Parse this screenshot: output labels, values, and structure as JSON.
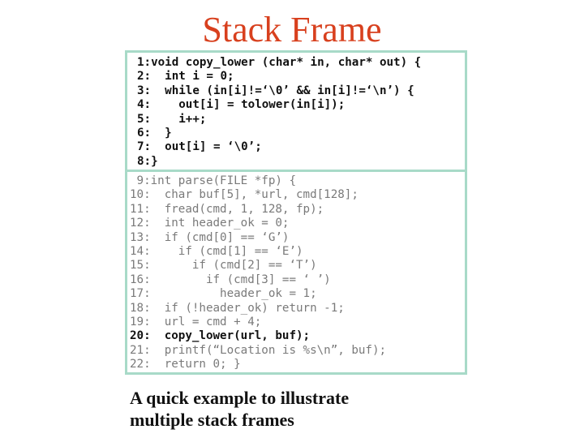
{
  "title": "Stack Frame",
  "colors": {
    "title": "#d8401e",
    "border": "#a8dac8",
    "active_code": "#111111",
    "inactive_code": "#7a7a7a"
  },
  "code_blocks": [
    {
      "function": "copy_lower",
      "active": true,
      "lines": [
        {
          "num": "1:",
          "text": "void copy_lower (char* in, char* out) {"
        },
        {
          "num": "2:",
          "text": "  int i = 0;"
        },
        {
          "num": "3:",
          "text": "  while (in[i]!=‘\\0’ && in[i]!=‘\\n’) {"
        },
        {
          "num": "4:",
          "text": "    out[i] = tolower(in[i]);"
        },
        {
          "num": "5:",
          "text": "    i++;"
        },
        {
          "num": "6:",
          "text": "  }"
        },
        {
          "num": "7:",
          "text": "  out[i] = ‘\\0’;"
        },
        {
          "num": "8:",
          "text": "}"
        }
      ]
    },
    {
      "function": "parse",
      "active": false,
      "highlighted_line": "20:",
      "lines": [
        {
          "num": " 9:",
          "text": "int parse(FILE *fp) {"
        },
        {
          "num": "10:",
          "text": "  char buf[5], *url, cmd[128];"
        },
        {
          "num": "11:",
          "text": "  fread(cmd, 1, 128, fp);"
        },
        {
          "num": "12:",
          "text": "  int header_ok = 0;"
        },
        {
          "num": "13:",
          "text": "  if (cmd[0] == ‘G’)"
        },
        {
          "num": "14:",
          "text": "    if (cmd[1] == ‘E’)"
        },
        {
          "num": "15:",
          "text": "      if (cmd[2] == ‘T’)"
        },
        {
          "num": "16:",
          "text": "        if (cmd[3] == ‘ ’)"
        },
        {
          "num": "17:",
          "text": "          header_ok = 1;"
        },
        {
          "num": "18:",
          "text": "  if (!header_ok) return -1;"
        },
        {
          "num": "19:",
          "text": "  url = cmd + 4;"
        },
        {
          "num": "20:",
          "text": "  copy_lower(url, buf);"
        },
        {
          "num": "21:",
          "text": "  printf(“Location is %s\\n”, buf);"
        },
        {
          "num": "22:",
          "text": "  return 0; }"
        }
      ]
    }
  ],
  "caption": {
    "line1": "A quick example to illustrate",
    "line2": "multiple stack frames"
  }
}
